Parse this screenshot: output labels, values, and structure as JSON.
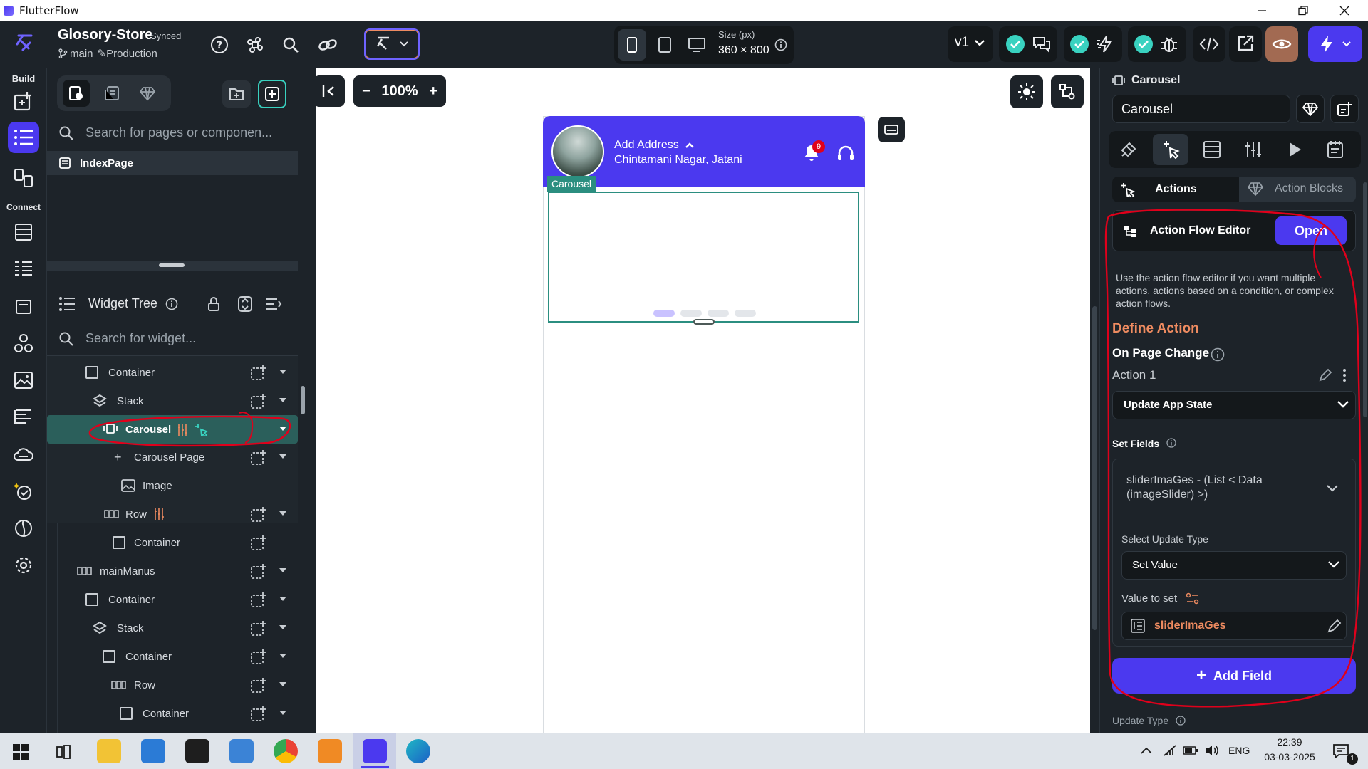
{
  "window": {
    "title": "FlutterFlow"
  },
  "project": {
    "name": "Glosory-Store",
    "sync_status": "Synced",
    "branch": "main",
    "environment": "Production"
  },
  "device": {
    "size_label": "Size (px)",
    "size_value": "360 × 800"
  },
  "version": {
    "label": "v1"
  },
  "rail": {
    "build_label": "Build",
    "connect_label": "Connect"
  },
  "pages_panel": {
    "search_placeholder": "Search for pages or componen...",
    "page_item": "IndexPage"
  },
  "widget_tree": {
    "title": "Widget Tree",
    "search_placeholder": "Search for widget...",
    "rows": [
      {
        "label": "Container"
      },
      {
        "label": "Stack"
      },
      {
        "label": "Carousel"
      },
      {
        "label": "Carousel Page"
      },
      {
        "label": "Image"
      },
      {
        "label": "Row"
      },
      {
        "label": "Container"
      },
      {
        "label": "mainManus"
      },
      {
        "label": "Container"
      },
      {
        "label": "Stack"
      },
      {
        "label": "Container"
      },
      {
        "label": "Row"
      },
      {
        "label": "Container"
      }
    ]
  },
  "canvas": {
    "zoom": "100%",
    "header": {
      "address_title": "Add Address",
      "address_line": "Chintamani Nagar, Jatani",
      "notification_count": "9"
    },
    "selected_label": "Carousel",
    "carousel_indicator_count": 4
  },
  "properties": {
    "widget_type": "Carousel",
    "widget_name": "Carousel",
    "tab_actions": "Actions",
    "tab_action_blocks": "Action Blocks",
    "action_flow_editor": "Action Flow Editor",
    "open_button": "Open",
    "description": "Use the action flow editor if you want multiple actions, actions based on a condition, or complex action flows.",
    "define_action": "Define Action",
    "trigger": "On Page Change",
    "action_name": "Action 1",
    "action_type": "Update App State",
    "set_fields": "Set Fields",
    "field_name": "sliderImaGes - (List < Data (imageSlider) >)",
    "select_update_type_label": "Select Update Type",
    "update_type": "Set Value",
    "value_to_set_label": "Value to set",
    "value": "sliderImaGes",
    "add_field_button": "Add Field",
    "update_type_footer": "Update Type"
  },
  "taskbar": {
    "language": "ENG",
    "time": "22:39",
    "date": "03-03-2025",
    "notification_count": "1"
  },
  "colors": {
    "accent": "#4b39ef",
    "selection_teal": "#2b5f5b",
    "success": "#39d2c0",
    "warning_orange": "#ee8b60",
    "annotation_red": "#e0001b",
    "panel_bg": "#1d2329"
  }
}
